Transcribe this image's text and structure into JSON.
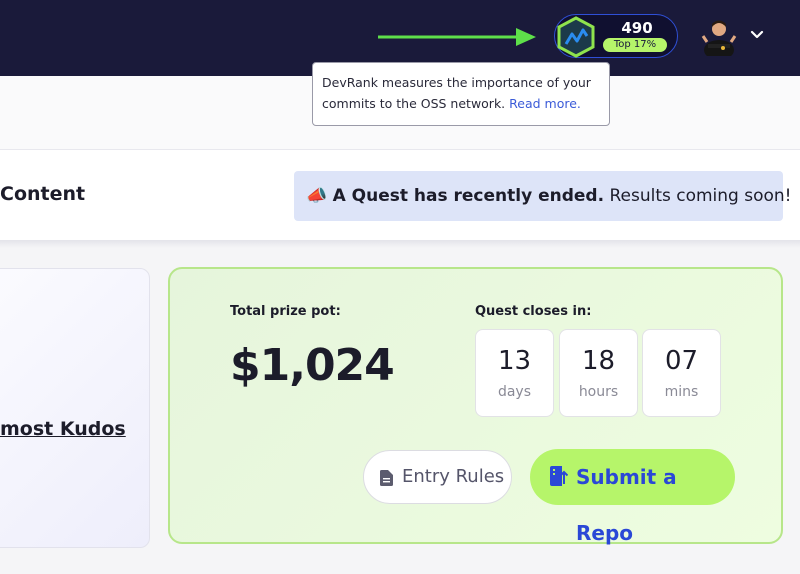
{
  "header": {
    "devrank": {
      "score": "490",
      "rank_badge": "Top 17%",
      "icon": "devrank-hexagon-icon"
    },
    "avatar_icon": "user-avatar",
    "menu_icon": "chevron-down-icon"
  },
  "tooltip": {
    "text": "DevRank measures the importance of your commits to the OSS network.",
    "link": "Read more."
  },
  "section": {
    "title": "Content"
  },
  "banner": {
    "emoji": "📣",
    "bold_text": "A Quest has recently ended.",
    "text": " Results coming soon!"
  },
  "left_card": {
    "link": "most Kudos"
  },
  "quest": {
    "prize_label": "Total prize pot:",
    "prize_amount": "$1,024",
    "closes_label": "Quest closes in:",
    "countdown": [
      {
        "value": "13",
        "unit": "days"
      },
      {
        "value": "18",
        "unit": "hours"
      },
      {
        "value": "07",
        "unit": "mins"
      }
    ],
    "entry_rules_label": "Entry Rules",
    "submit_label": "Submit a Repo"
  },
  "colors": {
    "topbar": "#1a1a3a",
    "accent_green": "#b6f56a",
    "accent_blue": "#2a48d6",
    "arrow": "#5ee04a"
  }
}
